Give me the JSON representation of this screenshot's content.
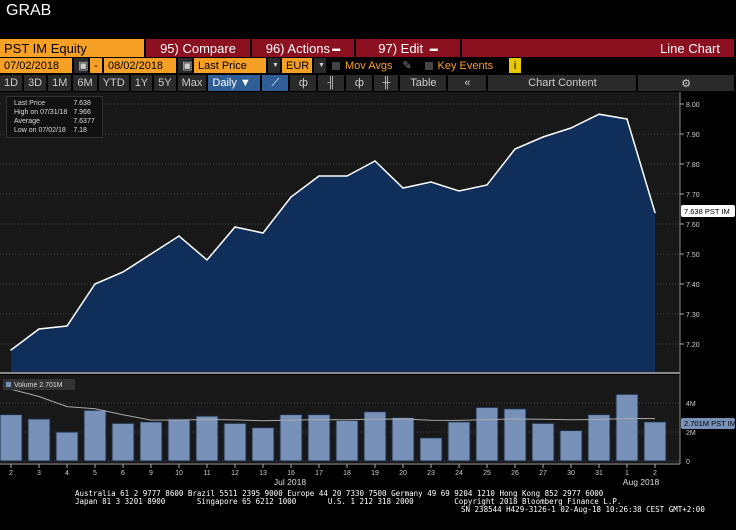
{
  "window_title": "GRAB",
  "toolbar": {
    "security": "PST IM Equity",
    "compare": "95) Compare",
    "actions": "96) Actions",
    "edit": "97) Edit",
    "chart_type": "Line Chart"
  },
  "controls": {
    "start_date": "07/02/2018",
    "dash": "-",
    "end_date": "08/02/2018",
    "field": "Last Price",
    "currency": "EUR",
    "mov_avgs": "Mov Avgs",
    "key_events": "Key Events",
    "info": "i"
  },
  "periods": [
    "1D",
    "3D",
    "1M",
    "6M",
    "YTD",
    "1Y",
    "5Y",
    "Max"
  ],
  "frequency": "Daily ▼",
  "view": {
    "table": "Table",
    "collapse": "«",
    "chart_content": "Chart Content",
    "settings": "⚙"
  },
  "legend": [
    {
      "label": "Last Price",
      "value": "7.638"
    },
    {
      "label": "High on 07/31/18",
      "value": "7.966"
    },
    {
      "label": "Average",
      "value": "7.6377"
    },
    {
      "label": "Low on 07/02/18",
      "value": "7.18"
    }
  ],
  "volume_legend": "Volume 2.701M",
  "price_tag": "7.638 PST IM",
  "volume_tag": "2.701M PST IM",
  "month_labels": [
    "Jul 2018",
    "Aug 2018"
  ],
  "chart_data": {
    "type": "line",
    "x": [
      "2",
      "3",
      "4",
      "5",
      "6",
      "9",
      "10",
      "11",
      "12",
      "13",
      "16",
      "17",
      "18",
      "19",
      "20",
      "23",
      "24",
      "25",
      "26",
      "27",
      "30",
      "31",
      "1",
      "2"
    ],
    "series": [
      {
        "name": "Last Price",
        "values": [
          7.18,
          7.25,
          7.26,
          7.4,
          7.44,
          7.5,
          7.56,
          7.48,
          7.59,
          7.57,
          7.69,
          7.76,
          7.76,
          7.81,
          7.72,
          7.74,
          7.71,
          7.73,
          7.85,
          7.89,
          7.92,
          7.966,
          7.95,
          7.638
        ]
      },
      {
        "name": "Volume (M)",
        "type": "bar",
        "values": [
          3.2,
          2.9,
          2.0,
          3.5,
          2.6,
          2.7,
          2.9,
          3.1,
          2.6,
          2.3,
          3.2,
          3.2,
          2.8,
          3.4,
          3.0,
          1.6,
          2.7,
          3.7,
          3.6,
          2.6,
          2.1,
          3.2,
          4.6,
          2.701
        ]
      }
    ],
    "ylim": [
      7.1,
      8.05
    ],
    "yticks": [
      "8.00",
      "7.90",
      "7.80",
      "7.70",
      "7.60",
      "7.50",
      "7.40",
      "7.30",
      "7.20"
    ],
    "vol_ticks": [
      "4M",
      "2M",
      "0"
    ],
    "vol_ylim": [
      0,
      6
    ]
  },
  "footer": {
    "line1": "Australia 61 2 9777 8600 Brazil 5511 2395 9000 Europe 44 20 7330 7500 Germany 49 69 9204 1210 Hong Kong 852 2977 6000",
    "line2": "Japan 81 3 3201 8900       Singapore 65 6212 1000       U.S. 1 212 318 2000         Copyright 2018 Bloomberg Finance L.P.",
    "line3": "SN 238544 H429-3126-1 02-Aug-18 10:26:38 CEST GMT+2:00"
  }
}
